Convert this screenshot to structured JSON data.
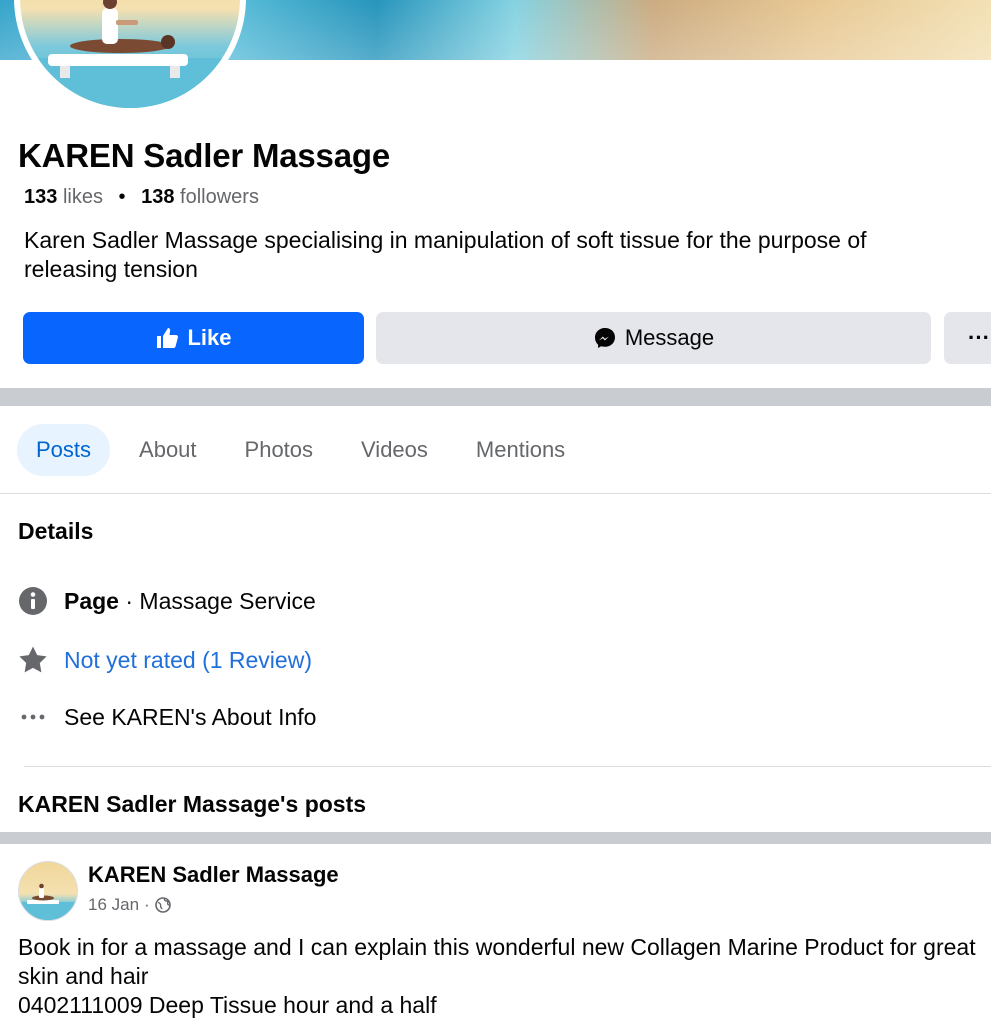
{
  "profile": {
    "name": "KAREN Sadler Massage",
    "likes_count": "133",
    "likes_label": "likes",
    "followers_count": "138",
    "followers_label": "followers",
    "separator": "•",
    "description": "Karen Sadler Massage specialising in manipulation of soft tissue for the purpose of releasing tension"
  },
  "actions": {
    "like_label": "Like",
    "message_label": "Message",
    "more_label": "···"
  },
  "tabs": [
    {
      "label": "Posts",
      "active": true
    },
    {
      "label": "About"
    },
    {
      "label": "Photos"
    },
    {
      "label": "Videos"
    },
    {
      "label": "Mentions"
    }
  ],
  "details": {
    "title": "Details",
    "category_bold": "Page",
    "category_rest": " · Massage Service",
    "rating": "Not yet rated (1 Review)",
    "about_link": "See KAREN's About Info"
  },
  "posts_section": {
    "title": "KAREN Sadler Massage's posts"
  },
  "post": {
    "author": "KAREN Sadler Massage",
    "date": "16 Jan",
    "meta_sep": "·",
    "body": "Book in for a massage and I can explain this wonderful new Collagen Marine Product for great skin and hair\n0402111009 Deep Tissue hour and a half"
  },
  "colors": {
    "like_blue": "#0866ff",
    "link_blue": "#216fdb",
    "active_tab_bg": "#e7f3ff",
    "secondary_button_bg": "#e4e6eb"
  }
}
